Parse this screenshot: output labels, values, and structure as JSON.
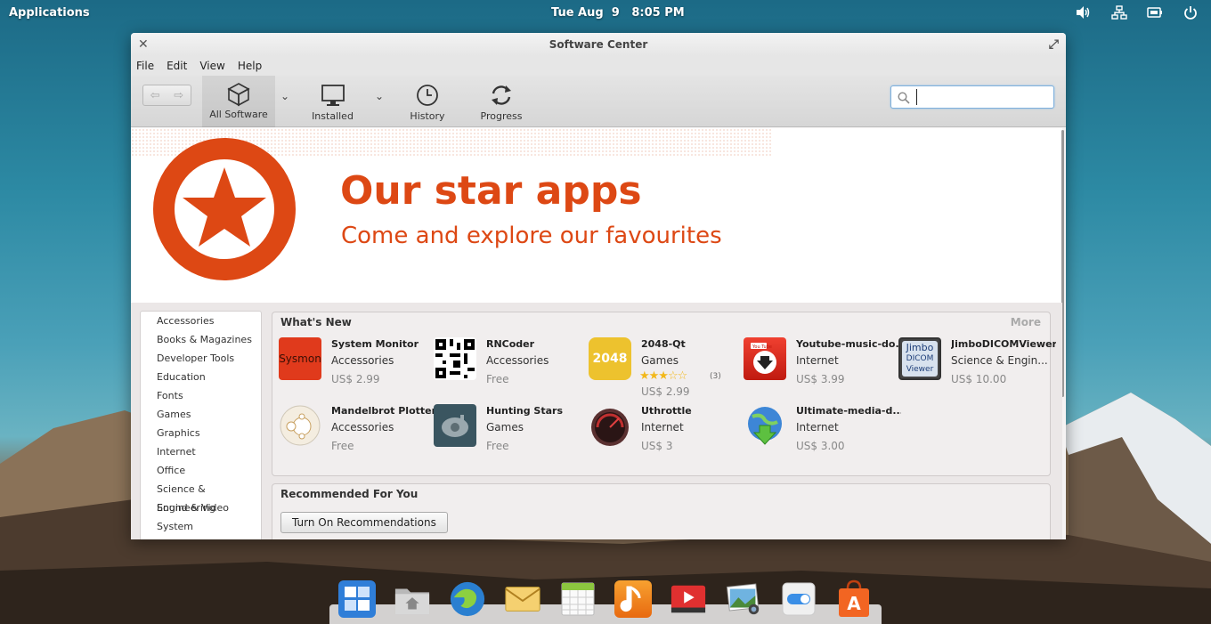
{
  "top_panel": {
    "applications": "Applications",
    "date": "Tue Aug  9",
    "time": "8:05 PM"
  },
  "window": {
    "title": "Software Center",
    "menu": [
      "File",
      "Edit",
      "View",
      "Help"
    ],
    "toolbar": {
      "all_software": "All Software",
      "installed": "Installed",
      "history": "History",
      "progress": "Progress"
    },
    "search": {
      "value": "",
      "placeholder": ""
    },
    "banner": {
      "title": "Our star apps",
      "subtitle": "Come and explore our favourites",
      "accent": "#dd4814"
    },
    "categories": [
      "Accessories",
      "Books & Magazines",
      "Developer Tools",
      "Education",
      "Fonts",
      "Games",
      "Graphics",
      "Internet",
      "Office",
      "Science & Engineering",
      "Sound & Video",
      "System"
    ],
    "whats_new": {
      "title": "What's New",
      "more": "More",
      "apps": [
        {
          "name": "System Monitor",
          "category": "Accessories",
          "price": "US$ 2.99",
          "icon": "sysmon-icon",
          "icon_text": "Sysmon"
        },
        {
          "name": "RNCoder",
          "category": "Accessories",
          "price": "Free",
          "icon": "qr-code-icon"
        },
        {
          "name": "2048-Qt",
          "category": "Games",
          "price": "US$ 2.99",
          "icon": "2048-icon",
          "icon_text": "2048",
          "rating": 3,
          "rating_count": "(3)"
        },
        {
          "name": "Youtube-music-do...",
          "category": "Internet",
          "price": "US$ 3.99",
          "icon": "youtube-download-icon",
          "icon_text": "You Tube"
        },
        {
          "name": "JimboDICOMViewer",
          "category": "Science & Engin...",
          "price": "US$ 10.00",
          "icon": "jimbo-dicom-icon",
          "icon_text": [
            "Jimbo",
            "DICOM",
            "Viewer"
          ]
        },
        {
          "name": "Mandelbrot Plotter",
          "category": "Accessories",
          "price": "Free",
          "icon": "mandelbrot-icon"
        },
        {
          "name": "Hunting Stars",
          "category": "Games",
          "price": "Free",
          "icon": "spaceship-icon"
        },
        {
          "name": "Uthrottle",
          "category": "Internet",
          "price": "US$ 3",
          "icon": "speedometer-icon"
        },
        {
          "name": "Ultimate-media-d...",
          "category": "Internet",
          "price": "US$ 3.00",
          "icon": "globe-download-icon"
        }
      ]
    },
    "recommended": {
      "title": "Recommended For You",
      "button": "Turn On Recommendations"
    }
  },
  "dock": [
    "multitasking-view-icon",
    "files-icon",
    "web-browser-icon",
    "mail-icon",
    "calendar-icon",
    "music-icon",
    "videos-icon",
    "photos-icon",
    "settings-icon",
    "software-center-icon"
  ]
}
